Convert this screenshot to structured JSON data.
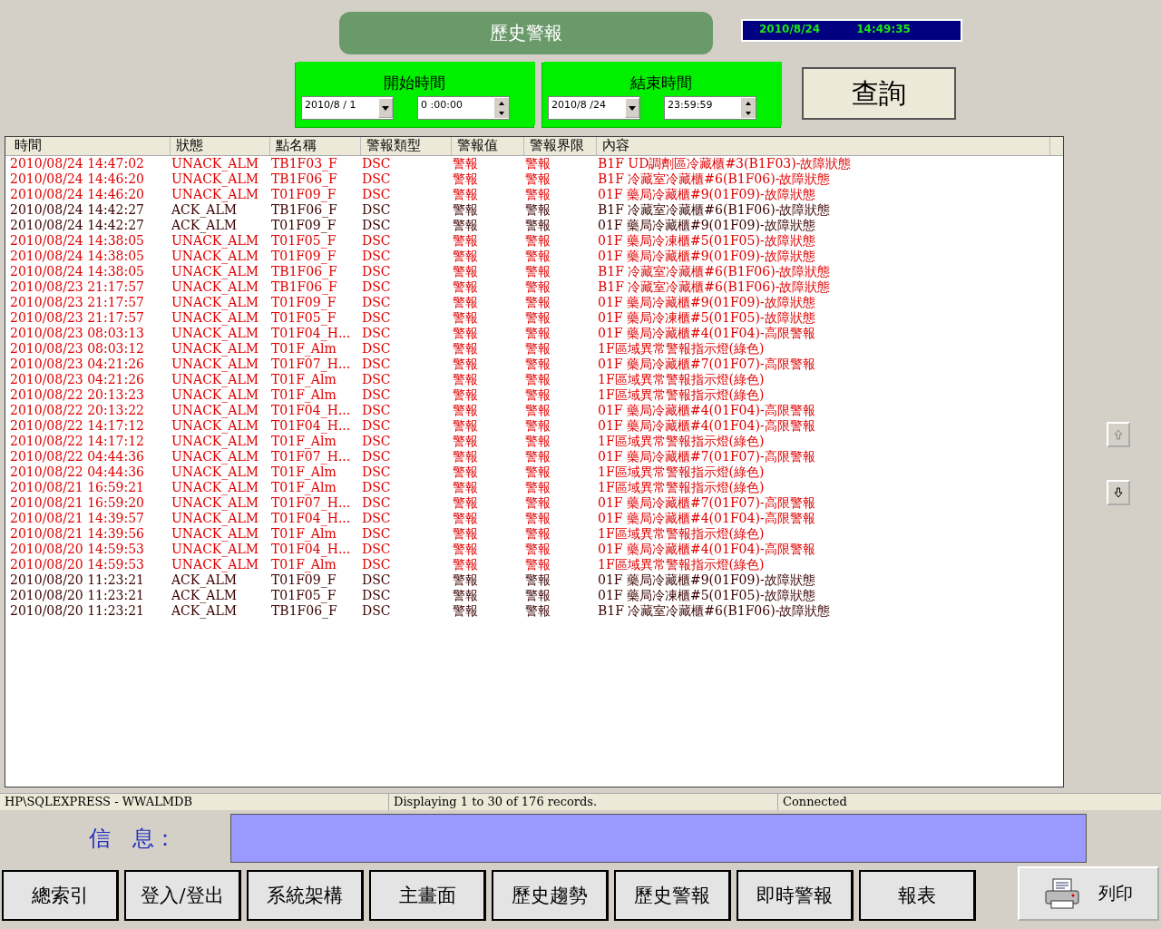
{
  "title": "歷史警報",
  "clock": {
    "date": "2010/8/24",
    "time": "14:49:35"
  },
  "start": {
    "label": "開始時間",
    "date": "2010/8 / 1",
    "time": "0 :00:00"
  },
  "end": {
    "label": "結束時間",
    "date": "2010/8 /24",
    "time": "23:59:59"
  },
  "query_button": "查詢",
  "table": {
    "columns": [
      "時間",
      "狀態",
      "點名稱",
      "警報類型",
      "警報值",
      "警報界限",
      "內容"
    ],
    "rows": [
      {
        "acknowledged": false,
        "cells": [
          "2010/08/24 14:47:02",
          "UNACK_ALM",
          "TB1F03_F",
          "DSC",
          "警報",
          "警報",
          "B1F UD調劑區冷藏櫃#3(B1F03)-故障狀態"
        ]
      },
      {
        "acknowledged": false,
        "cells": [
          "2010/08/24 14:46:20",
          "UNACK_ALM",
          "TB1F06_F",
          "DSC",
          "警報",
          "警報",
          "B1F 冷藏室冷藏櫃#6(B1F06)-故障狀態"
        ]
      },
      {
        "acknowledged": false,
        "cells": [
          "2010/08/24 14:46:20",
          "UNACK_ALM",
          "T01F09_F",
          "DSC",
          "警報",
          "警報",
          "01F 藥局冷藏櫃#9(01F09)-故障狀態"
        ]
      },
      {
        "acknowledged": true,
        "cells": [
          "2010/08/24 14:42:27",
          "ACK_ALM",
          "TB1F06_F",
          "DSC",
          "警報",
          "警報",
          "B1F 冷藏室冷藏櫃#6(B1F06)-故障狀態"
        ]
      },
      {
        "acknowledged": true,
        "cells": [
          "2010/08/24 14:42:27",
          "ACK_ALM",
          "T01F09_F",
          "DSC",
          "警報",
          "警報",
          "01F 藥局冷藏櫃#9(01F09)-故障狀態"
        ]
      },
      {
        "acknowledged": false,
        "cells": [
          "2010/08/24 14:38:05",
          "UNACK_ALM",
          "T01F05_F",
          "DSC",
          "警報",
          "警報",
          "01F 藥局冷凍櫃#5(01F05)-故障狀態"
        ]
      },
      {
        "acknowledged": false,
        "cells": [
          "2010/08/24 14:38:05",
          "UNACK_ALM",
          "T01F09_F",
          "DSC",
          "警報",
          "警報",
          "01F 藥局冷藏櫃#9(01F09)-故障狀態"
        ]
      },
      {
        "acknowledged": false,
        "cells": [
          "2010/08/24 14:38:05",
          "UNACK_ALM",
          "TB1F06_F",
          "DSC",
          "警報",
          "警報",
          "B1F 冷藏室冷藏櫃#6(B1F06)-故障狀態"
        ]
      },
      {
        "acknowledged": false,
        "cells": [
          "2010/08/23 21:17:57",
          "UNACK_ALM",
          "TB1F06_F",
          "DSC",
          "警報",
          "警報",
          "B1F 冷藏室冷藏櫃#6(B1F06)-故障狀態"
        ]
      },
      {
        "acknowledged": false,
        "cells": [
          "2010/08/23 21:17:57",
          "UNACK_ALM",
          "T01F09_F",
          "DSC",
          "警報",
          "警報",
          "01F 藥局冷藏櫃#9(01F09)-故障狀態"
        ]
      },
      {
        "acknowledged": false,
        "cells": [
          "2010/08/23 21:17:57",
          "UNACK_ALM",
          "T01F05_F",
          "DSC",
          "警報",
          "警報",
          "01F 藥局冷凍櫃#5(01F05)-故障狀態"
        ]
      },
      {
        "acknowledged": false,
        "cells": [
          "2010/08/23 08:03:13",
          "UNACK_ALM",
          "T01F04_H...",
          "DSC",
          "警報",
          "警報",
          "01F 藥局冷藏櫃#4(01F04)-高限警報"
        ]
      },
      {
        "acknowledged": false,
        "cells": [
          "2010/08/23 08:03:12",
          "UNACK_ALM",
          "T01F_Alm",
          "DSC",
          "警報",
          "警報",
          "1F區域異常警報指示燈(綠色)"
        ]
      },
      {
        "acknowledged": false,
        "cells": [
          "2010/08/23 04:21:26",
          "UNACK_ALM",
          "T01F07_H...",
          "DSC",
          "警報",
          "警報",
          "01F 藥局冷藏櫃#7(01F07)-高限警報"
        ]
      },
      {
        "acknowledged": false,
        "cells": [
          "2010/08/23 04:21:26",
          "UNACK_ALM",
          "T01F_Alm",
          "DSC",
          "警報",
          "警報",
          "1F區域異常警報指示燈(綠色)"
        ]
      },
      {
        "acknowledged": false,
        "cells": [
          "2010/08/22 20:13:23",
          "UNACK_ALM",
          "T01F_Alm",
          "DSC",
          "警報",
          "警報",
          "1F區域異常警報指示燈(綠色)"
        ]
      },
      {
        "acknowledged": false,
        "cells": [
          "2010/08/22 20:13:22",
          "UNACK_ALM",
          "T01F04_H...",
          "DSC",
          "警報",
          "警報",
          "01F 藥局冷藏櫃#4(01F04)-高限警報"
        ]
      },
      {
        "acknowledged": false,
        "cells": [
          "2010/08/22 14:17:12",
          "UNACK_ALM",
          "T01F04_H...",
          "DSC",
          "警報",
          "警報",
          "01F 藥局冷藏櫃#4(01F04)-高限警報"
        ]
      },
      {
        "acknowledged": false,
        "cells": [
          "2010/08/22 14:17:12",
          "UNACK_ALM",
          "T01F_Alm",
          "DSC",
          "警報",
          "警報",
          "1F區域異常警報指示燈(綠色)"
        ]
      },
      {
        "acknowledged": false,
        "cells": [
          "2010/08/22 04:44:36",
          "UNACK_ALM",
          "T01F07_H...",
          "DSC",
          "警報",
          "警報",
          "01F 藥局冷藏櫃#7(01F07)-高限警報"
        ]
      },
      {
        "acknowledged": false,
        "cells": [
          "2010/08/22 04:44:36",
          "UNACK_ALM",
          "T01F_Alm",
          "DSC",
          "警報",
          "警報",
          "1F區域異常警報指示燈(綠色)"
        ]
      },
      {
        "acknowledged": false,
        "cells": [
          "2010/08/21 16:59:21",
          "UNACK_ALM",
          "T01F_Alm",
          "DSC",
          "警報",
          "警報",
          "1F區域異常警報指示燈(綠色)"
        ]
      },
      {
        "acknowledged": false,
        "cells": [
          "2010/08/21 16:59:20",
          "UNACK_ALM",
          "T01F07_H...",
          "DSC",
          "警報",
          "警報",
          "01F 藥局冷藏櫃#7(01F07)-高限警報"
        ]
      },
      {
        "acknowledged": false,
        "cells": [
          "2010/08/21 14:39:57",
          "UNACK_ALM",
          "T01F04_H...",
          "DSC",
          "警報",
          "警報",
          "01F 藥局冷藏櫃#4(01F04)-高限警報"
        ]
      },
      {
        "acknowledged": false,
        "cells": [
          "2010/08/21 14:39:56",
          "UNACK_ALM",
          "T01F_Alm",
          "DSC",
          "警報",
          "警報",
          "1F區域異常警報指示燈(綠色)"
        ]
      },
      {
        "acknowledged": false,
        "cells": [
          "2010/08/20 14:59:53",
          "UNACK_ALM",
          "T01F04_H...",
          "DSC",
          "警報",
          "警報",
          "01F 藥局冷藏櫃#4(01F04)-高限警報"
        ]
      },
      {
        "acknowledged": false,
        "cells": [
          "2010/08/20 14:59:53",
          "UNACK_ALM",
          "T01F_Alm",
          "DSC",
          "警報",
          "警報",
          "1F區域異常警報指示燈(綠色)"
        ]
      },
      {
        "acknowledged": true,
        "cells": [
          "2010/08/20 11:23:21",
          "ACK_ALM",
          "T01F09_F",
          "DSC",
          "警報",
          "警報",
          "01F 藥局冷藏櫃#9(01F09)-故障狀態"
        ]
      },
      {
        "acknowledged": true,
        "cells": [
          "2010/08/20 11:23:21",
          "ACK_ALM",
          "T01F05_F",
          "DSC",
          "警報",
          "警報",
          "01F 藥局冷凍櫃#5(01F05)-故障狀態"
        ]
      },
      {
        "acknowledged": true,
        "cells": [
          "2010/08/20 11:23:21",
          "ACK_ALM",
          "TB1F06_F",
          "DSC",
          "警報",
          "警報",
          "B1F 冷藏室冷藏櫃#6(B1F06)-故障狀態"
        ]
      }
    ]
  },
  "status_bar": [
    "HP\\SQLEXPRESS - WWALMDB",
    "Displaying 1 to 30 of 176 records.",
    "Connected"
  ],
  "message": {
    "label": "信　息："
  },
  "nav_buttons": [
    "總索引",
    "登入/登出",
    "系統架構",
    "主畫面",
    "歷史趨勢",
    "歷史警報",
    "即時警報",
    "報表"
  ],
  "print_button": "列印"
}
